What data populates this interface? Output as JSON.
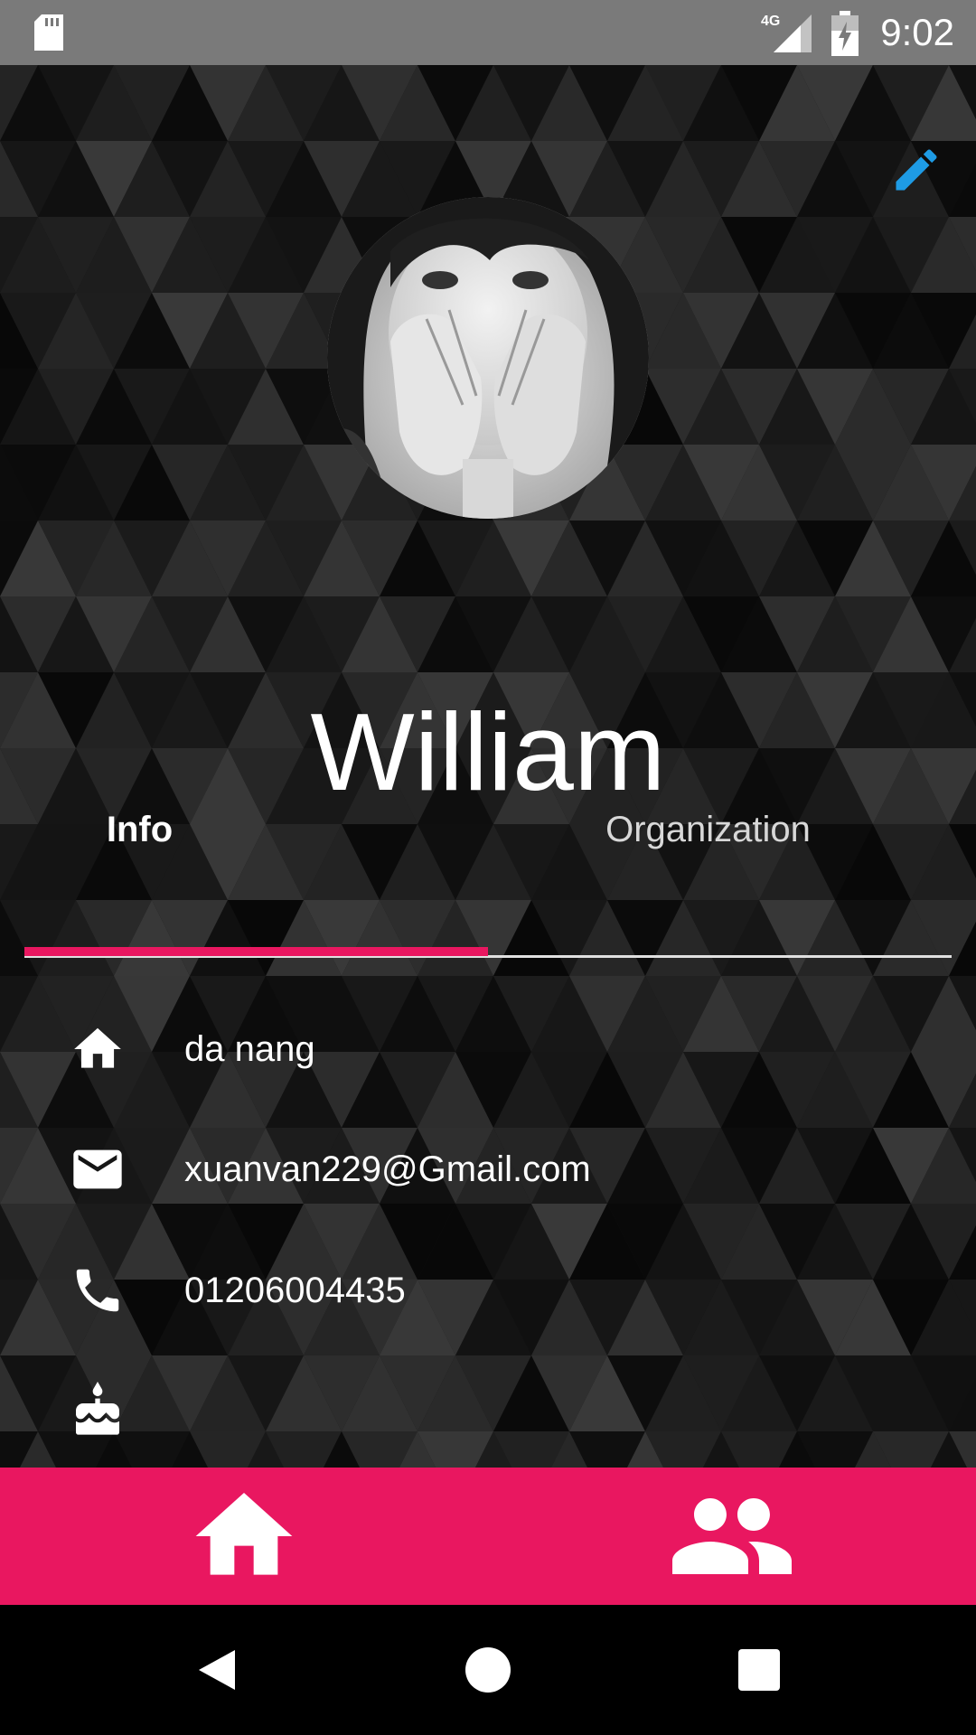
{
  "status_bar": {
    "time": "9:02",
    "network": "4G",
    "icons": [
      "sd-card-icon",
      "signal-icon",
      "battery-icon"
    ]
  },
  "profile": {
    "name": "William",
    "avatar_icon": "profile-photo",
    "edit_icon": "pencil-icon"
  },
  "tabs": [
    {
      "label": "Info",
      "selected": true
    },
    {
      "label": "Organization",
      "selected": false
    }
  ],
  "info": {
    "address": "da nang",
    "email": "xuanvan229@Gmail.com",
    "phone": "01206004435",
    "birthday": ""
  },
  "bottom_nav": {
    "items": [
      "home-icon",
      "people-icon"
    ]
  },
  "system_nav": {
    "items": [
      "back-icon",
      "home-circle-icon",
      "recents-icon"
    ]
  },
  "colors": {
    "accent": "#e91760",
    "edit": "#1e9be5",
    "status_bar": "#7a7a7a"
  }
}
